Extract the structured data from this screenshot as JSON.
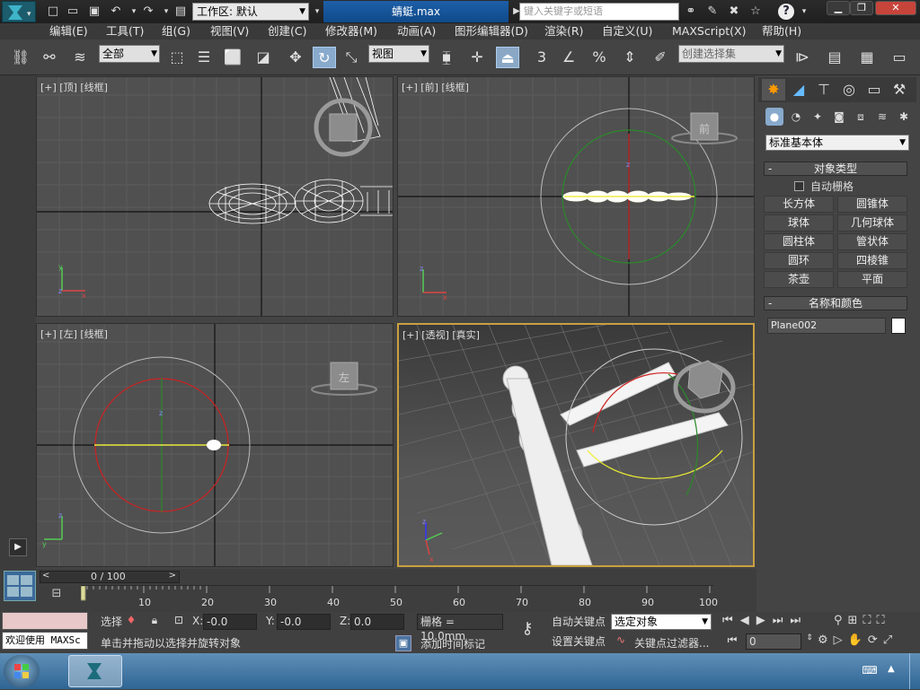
{
  "titlebar": {
    "workspace_label": "工作区: 默认",
    "file_title": "蜻蜓.max",
    "search_placeholder": "键入关键字或短语",
    "help": "?"
  },
  "menubar": {
    "items": [
      "编辑(E)",
      "工具(T)",
      "组(G)",
      "视图(V)",
      "创建(C)",
      "修改器(M)",
      "动画(A)",
      "图形编辑器(D)",
      "渲染(R)",
      "自定义(U)",
      "MAXScript(X)",
      "帮助(H)"
    ]
  },
  "toolbar": {
    "filter_value": "全部",
    "refcoord_value": "视图",
    "snap_number": "3",
    "named_selection_placeholder": "创建选择集"
  },
  "viewports": {
    "top": "[+] [顶] [线框]",
    "front": "[+] [前] [线框]",
    "left": "[+] [左] [线框]",
    "persp": "[+] [透视] [真实]",
    "cube_front": "前",
    "cube_left": "左"
  },
  "command_panel": {
    "primitive_dropdown": "标准基本体",
    "object_type_title": "对象类型",
    "autogrid_label": "自动栅格",
    "buttons": [
      "长方体",
      "圆锥体",
      "球体",
      "几何球体",
      "圆柱体",
      "管状体",
      "圆环",
      "四棱锥",
      "茶壶",
      "平面"
    ],
    "name_color_title": "名称和颜色",
    "object_name": "Plane002",
    "collapse_marker": "-"
  },
  "timeline": {
    "frame_counter": "0 / 100",
    "ticks": [
      "10",
      "20",
      "30",
      "40",
      "50",
      "60",
      "70",
      "80",
      "90",
      "100"
    ]
  },
  "status": {
    "welcome": "欢迎使用 MAXSc",
    "select_label": "选择",
    "prompt": "单击并拖动以选择并旋转对象",
    "x_label": "X:",
    "x_value": "-0.0",
    "y_label": "Y:",
    "y_value": "-0.0",
    "z_label": "Z:",
    "z_value": "0.0",
    "grid": "栅格 = 10.0mm",
    "add_time_tag": "添加时间标记",
    "auto_key": "自动关键点",
    "set_key": "设置关键点",
    "selection_filter": "选定对象",
    "key_filters": "关键点过滤器...",
    "current_frame": "0"
  },
  "colors": {
    "viewport_bg": "#505050",
    "active_border": "#c9a040",
    "titlebar_active": "#1d5fa8"
  }
}
